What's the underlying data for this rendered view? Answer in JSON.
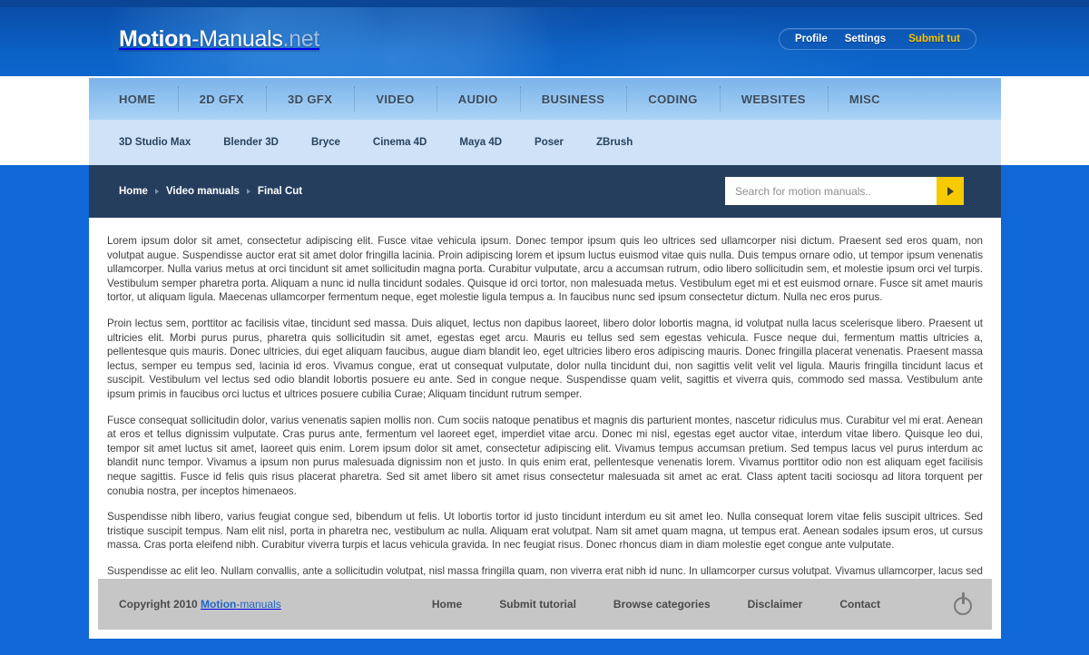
{
  "site": {
    "logo_bold": "Motion",
    "logo_regular": "-Manuals",
    "logo_tld": ".net",
    "accent_color": "#fdc700",
    "header_blue": "#0a55b4",
    "page_blue": "#1068d8",
    "crumbbar_navy": "#263e5e"
  },
  "userbar": {
    "profile": "Profile",
    "settings": "Settings",
    "submit": "Submit tut"
  },
  "nav_main": {
    "items": [
      {
        "label": "HOME"
      },
      {
        "label": "2D GFX"
      },
      {
        "label": "3D GFX"
      },
      {
        "label": "VIDEO"
      },
      {
        "label": "AUDIO"
      },
      {
        "label": "BUSINESS"
      },
      {
        "label": "CODING"
      },
      {
        "label": "WEBSITES"
      },
      {
        "label": "MISC"
      }
    ]
  },
  "nav_sub": {
    "items": [
      {
        "label": "3D Studio Max"
      },
      {
        "label": "Blender 3D"
      },
      {
        "label": "Bryce"
      },
      {
        "label": "Cinema 4D"
      },
      {
        "label": "Maya 4D"
      },
      {
        "label": "Poser"
      },
      {
        "label": "ZBrush"
      }
    ]
  },
  "breadcrumb": {
    "items": [
      {
        "label": "Home"
      },
      {
        "label": "Video manuals"
      },
      {
        "label": "Final Cut"
      }
    ]
  },
  "search": {
    "placeholder": "Search for motion manuals..",
    "value": "",
    "button_icon": "play-arrow-icon"
  },
  "article": {
    "paragraphs": [
      "Lorem ipsum dolor sit amet, consectetur adipiscing elit. Fusce vitae vehicula ipsum. Donec tempor ipsum quis leo ultrices sed ullamcorper nisi dictum. Praesent sed eros quam, non volutpat augue. Suspendisse auctor erat sit amet dolor fringilla lacinia. Proin adipiscing lorem et ipsum luctus euismod vitae quis nulla. Duis tempus ornare odio, ut tempor ipsum venenatis ullamcorper. Nulla varius metus at orci tincidunt sit amet sollicitudin magna porta. Curabitur vulputate, arcu a accumsan rutrum, odio libero sollicitudin sem, et molestie ipsum orci vel turpis. Vestibulum semper pharetra porta. Aliquam a nunc id nulla tincidunt sodales. Quisque id orci tortor, non malesuada metus. Vestibulum eget mi et est euismod ornare. Fusce sit amet mauris tortor, ut aliquam ligula. Maecenas ullamcorper fermentum neque, eget molestie ligula tempus a. In faucibus nunc sed ipsum consectetur dictum. Nulla nec eros purus.",
      "Proin lectus sem, porttitor ac facilisis vitae, tincidunt sed massa. Duis aliquet, lectus non dapibus laoreet, libero dolor lobortis magna, id volutpat nulla lacus scelerisque libero. Praesent ut ultricies elit. Morbi purus purus, pharetra quis sollicitudin sit amet, egestas eget arcu. Mauris eu tellus sed sem egestas vehicula. Fusce neque dui, fermentum mattis ultricies a, pellentesque quis mauris. Donec ultricies, dui eget aliquam faucibus, augue diam blandit leo, eget ultricies libero eros adipiscing mauris. Donec fringilla placerat venenatis. Praesent massa lectus, semper eu tempus sed, lacinia id eros. Vivamus congue, erat ut consequat vulputate, dolor nulla tincidunt dui, non sagittis velit velit vel ligula. Mauris fringilla tincidunt lacus et suscipit. Vestibulum vel lectus sed odio blandit lobortis posuere eu ante. Sed in congue neque. Suspendisse quam velit, sagittis et viverra quis, commodo sed massa. Vestibulum ante ipsum primis in faucibus orci luctus et ultrices posuere cubilia Curae; Aliquam tincidunt rutrum semper.",
      "Fusce consequat sollicitudin dolor, varius venenatis sapien mollis non. Cum sociis natoque penatibus et magnis dis parturient montes, nascetur ridiculus mus. Curabitur vel mi erat. Aenean at eros et tellus dignissim vulputate. Cras purus ante, fermentum vel laoreet eget, imperdiet vitae arcu. Donec mi nisl, egestas eget auctor vitae, interdum vitae libero. Quisque leo dui, tempor sit amet luctus sit amet, laoreet quis enim. Lorem ipsum dolor sit amet, consectetur adipiscing elit. Vivamus tempus accumsan pretium. Sed tempus lacus vel purus interdum ac blandit nunc tempor. Vivamus a ipsum non purus malesuada dignissim non et justo. In quis enim erat, pellentesque venenatis lorem. Vivamus porttitor odio non est aliquam eget facilisis neque sagittis. Fusce id felis quis risus placerat pharetra. Sed sit amet libero sit amet risus consectetur malesuada sit amet ac erat. Class aptent taciti sociosqu ad litora torquent per conubia nostra, per inceptos himenaeos.",
      "Suspendisse nibh libero, varius feugiat congue sed, bibendum ut felis. Ut lobortis tortor id justo tincidunt interdum eu sit amet leo. Nulla consequat lorem vitae felis suscipit ultrices. Sed tristique suscipit tempus. Nam elit nisl, porta in pharetra nec, vestibulum ac nulla. Aliquam erat volutpat. Nam sit amet quam magna, ut tempus erat. Aenean sodales ipsum eros, ut cursus massa. Cras porta eleifend nibh. Curabitur viverra turpis et lacus vehicula gravida. In nec feugiat risus. Donec rhoncus diam in diam molestie eget congue ante vulputate.",
      "Suspendisse ac elit leo. Nullam convallis, ante a sollicitudin volutpat, nisl massa fringilla quam, non viverra erat nibh id nunc. In ullamcorper cursus volutpat. Vivamus ullamcorper, lacus sed cursus porttitor, lacus mauris fermentum lacus, quis feugiat ligula augue sit amet mauris. Donec tincidunt semper eros sed gravida. Sed non leo massa. Cras dignissim scelerisque lacus non lacinia. Phasellus in purus in nisi faucibus rutrum vel sed lectus. Morbi ornare malesuada ante, quis molestie justo vestibulum placerat. Etiam tristique leo at metus laoreet et condimentum mi consequat."
    ]
  },
  "footer": {
    "copyright_text": "Copyright 2010",
    "brand_bold": "Motion",
    "brand_regular": "-manuals",
    "links": [
      {
        "label": "Home"
      },
      {
        "label": "Submit tutorial"
      },
      {
        "label": "Browse categories"
      },
      {
        "label": "Disclaimer"
      },
      {
        "label": "Contact"
      }
    ],
    "icon": "power-icon"
  }
}
